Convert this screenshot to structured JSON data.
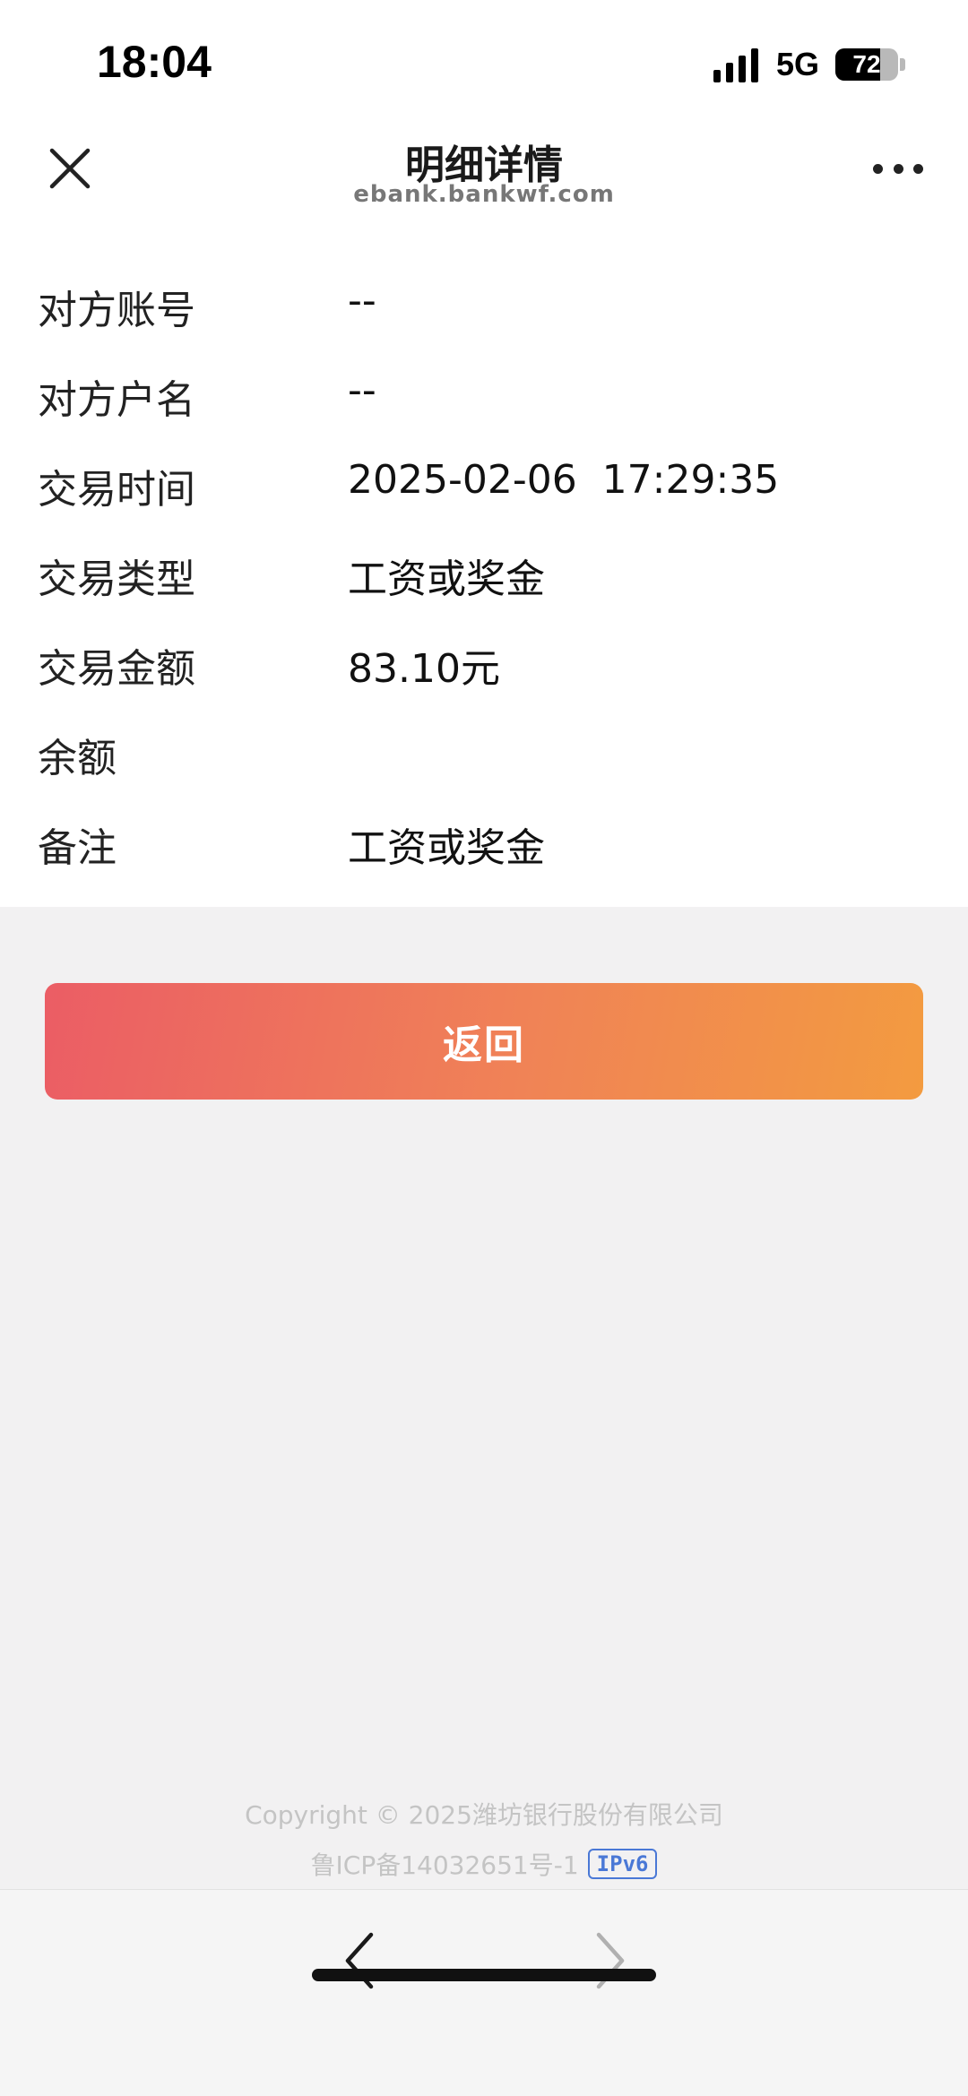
{
  "status_bar": {
    "time": "18:04",
    "network": "5G",
    "battery_level": "72",
    "battery_fraction": 0.72
  },
  "header": {
    "title": "明细详情",
    "subtitle": "ebank.bankwf.com",
    "close_icon": "close-icon",
    "more_icon": "more-icon"
  },
  "details": [
    {
      "label": "对方账号",
      "value": "--"
    },
    {
      "label": "对方户名",
      "value": "--"
    },
    {
      "label": "交易时间",
      "value": "2025-02-06  17:29:35"
    },
    {
      "label": "交易类型",
      "value": "工资或奖金"
    },
    {
      "label": "交易金额",
      "value": "83.10元"
    },
    {
      "label": "余额",
      "value": ""
    },
    {
      "label": "备注",
      "value": "工资或奖金"
    }
  ],
  "return_button": {
    "label": "返回"
  },
  "footer": {
    "copyright": "Copyright © 2025潍坊银行股份有限公司",
    "icp": "鲁ICP备14032651号-1",
    "ipv6_badge": "IPv6"
  },
  "toolbar": {
    "back_icon": "chevron-left-icon",
    "forward_icon": "chevron-right-icon"
  },
  "colors": {
    "button_gradient_start": "#eb5d65",
    "button_gradient_end": "#f39b40",
    "ipv6_blue": "#4a78d6"
  }
}
